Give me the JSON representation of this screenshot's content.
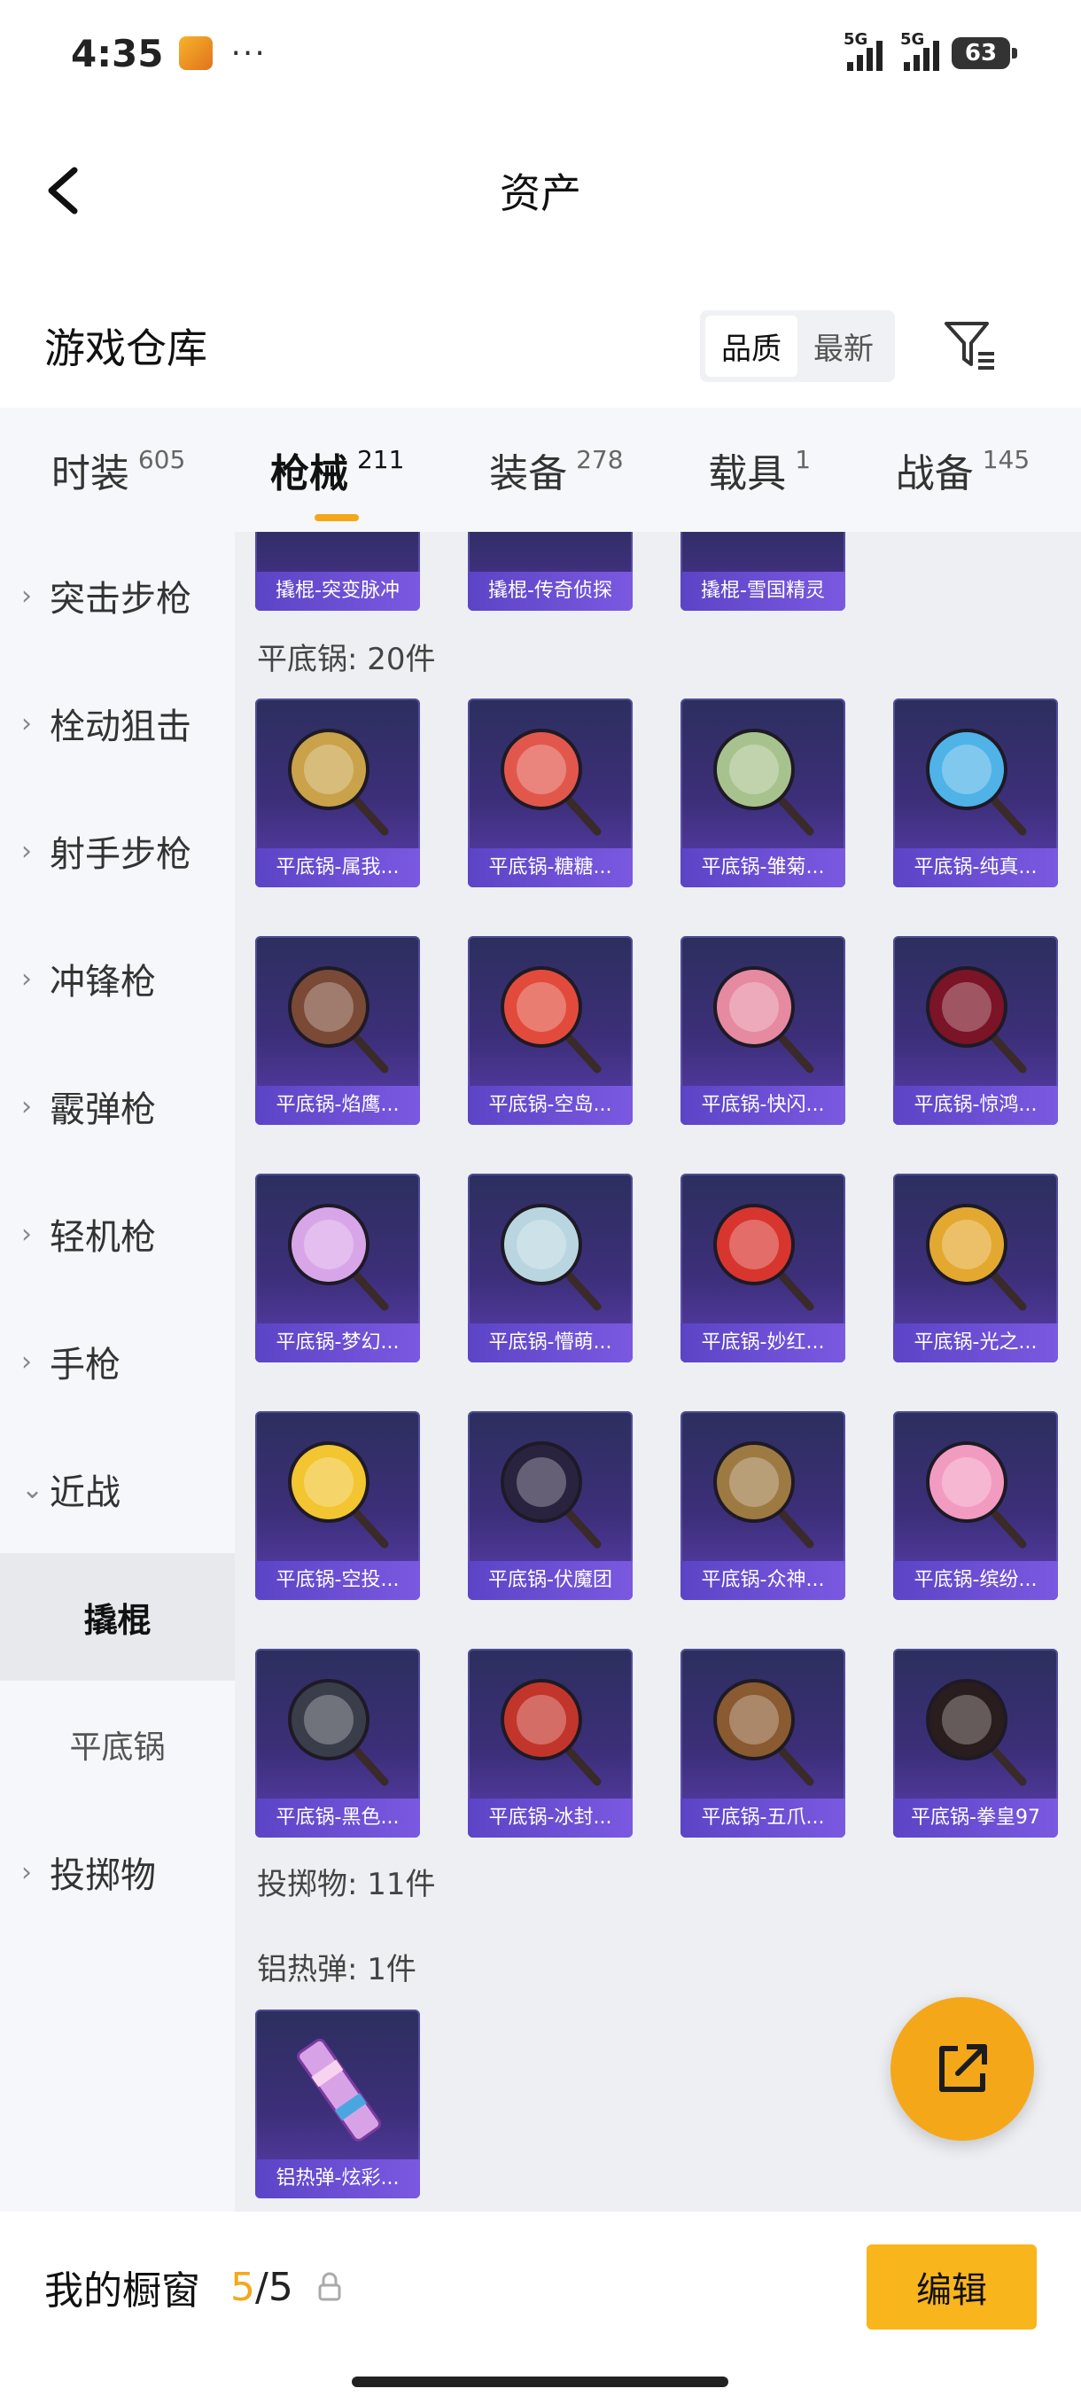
{
  "status": {
    "time": "4:35",
    "dots": "···",
    "sig1_label": "5G",
    "sig2_label": "5G",
    "battery": "63"
  },
  "header": {
    "title": "资产"
  },
  "warehouse": {
    "title": "游戏仓库",
    "sort_options": [
      "品质",
      "最新"
    ],
    "sort_active": "品质"
  },
  "tabs": [
    {
      "label": "时装",
      "count": "605"
    },
    {
      "label": "枪械",
      "count": "211",
      "active": true
    },
    {
      "label": "装备",
      "count": "278"
    },
    {
      "label": "载具",
      "count": "1"
    },
    {
      "label": "战备",
      "count": "145"
    }
  ],
  "sidebar": {
    "items": [
      {
        "label": "突击步枪",
        "chevron": "›"
      },
      {
        "label": "栓动狙击",
        "chevron": "›"
      },
      {
        "label": "射手步枪",
        "chevron": "›"
      },
      {
        "label": "冲锋枪",
        "chevron": "›"
      },
      {
        "label": "霰弹枪",
        "chevron": "›"
      },
      {
        "label": "轻机枪",
        "chevron": "›"
      },
      {
        "label": "手枪",
        "chevron": "›"
      },
      {
        "label": "近战",
        "chevron": "⌄"
      },
      {
        "label": "撬棍",
        "sub": true,
        "active": true
      },
      {
        "label": "平底锅",
        "sub": true
      },
      {
        "label": "投掷物",
        "chevron": "›"
      }
    ]
  },
  "content": {
    "crowbar_row": [
      "撬棍-突变脉冲",
      "撬棍-传奇侦探",
      "撬棍-雪国精灵"
    ],
    "pan_section": "平底锅: 20件",
    "pan_items": [
      {
        "label": "平底锅-属我...",
        "color": "#c9a24a"
      },
      {
        "label": "平底锅-糖糖...",
        "color": "#e2574c"
      },
      {
        "label": "平底锅-雏菊...",
        "color": "#a8c28e"
      },
      {
        "label": "平底锅-纯真...",
        "color": "#4fb3e8"
      },
      {
        "label": "平底锅-焰鹰...",
        "color": "#7a4a36"
      },
      {
        "label": "平底锅-空岛...",
        "color": "#e24b3b"
      },
      {
        "label": "平底锅-快闪...",
        "color": "#e58aa0"
      },
      {
        "label": "平底锅-惊鸿...",
        "color": "#7a1426"
      },
      {
        "label": "平底锅-梦幻...",
        "color": "#d8a6e8"
      },
      {
        "label": "平底锅-懵萌...",
        "color": "#b9d6e0"
      },
      {
        "label": "平底锅-妙红...",
        "color": "#d8352e"
      },
      {
        "label": "平底锅-光之...",
        "color": "#e3a82f"
      },
      {
        "label": "平底锅-空投...",
        "color": "#f2c531"
      },
      {
        "label": "平底锅-伏魔团",
        "color": "#2a2340"
      },
      {
        "label": "平底锅-众神...",
        "color": "#9e7a43"
      },
      {
        "label": "平底锅-缤纷...",
        "color": "#f29bc0"
      },
      {
        "label": "平底锅-黑色...",
        "color": "#3a3d4a"
      },
      {
        "label": "平底锅-冰封...",
        "color": "#c2352b"
      },
      {
        "label": "平底锅-五爪...",
        "color": "#8a5a30"
      },
      {
        "label": "平底锅-拳皇97",
        "color": "#2a1d1d"
      }
    ],
    "throwable_section": "投掷物: 11件",
    "thermite_section": "铝热弹: 1件",
    "thermite_items": [
      {
        "label": "铝热弹-炫彩...",
        "color": "#d7a3e6"
      }
    ]
  },
  "bottom": {
    "title": "我的橱窗",
    "current": "5",
    "slash": "/",
    "total": "5",
    "edit_label": "编辑"
  }
}
